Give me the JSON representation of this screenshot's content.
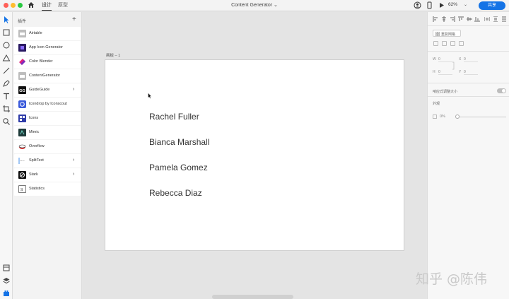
{
  "titlebar": {
    "mode_tabs": [
      "设计",
      "原型"
    ],
    "document_title": "Content Generator ⌄",
    "zoom": "62%",
    "zoom_arrow": "⌄",
    "share_label": "共享"
  },
  "colors": {
    "accent": "#1473e6",
    "close": "#ff5f57",
    "minimize": "#febc2e",
    "maximize": "#28c840"
  },
  "plugins": {
    "header": "插件",
    "add": "+",
    "items": [
      {
        "label": "Airtable",
        "icon": "airtable-icon",
        "chevron": ""
      },
      {
        "label": "App Icon Generator",
        "icon": "app-icon-generator-icon",
        "chevron": ""
      },
      {
        "label": "Color Blender",
        "icon": "color-blender-icon",
        "chevron": ""
      },
      {
        "label": "ContentGenerator",
        "icon": "content-generator-icon",
        "chevron": ""
      },
      {
        "label": "GuideGuide",
        "icon": "guideguide-icon",
        "chevron": "›"
      },
      {
        "label": "Icondrop by Iconscout",
        "icon": "icondrop-icon",
        "chevron": ""
      },
      {
        "label": "Icons",
        "icon": "icons-plugin-icon",
        "chevron": ""
      },
      {
        "label": "Mimic",
        "icon": "mimic-icon",
        "chevron": ""
      },
      {
        "label": "Overflow",
        "icon": "overflow-icon",
        "chevron": ""
      },
      {
        "label": "SplitText",
        "icon": "splittext-icon",
        "chevron": "›"
      },
      {
        "label": "Stark",
        "icon": "stark-icon",
        "chevron": "›"
      },
      {
        "label": "Statistics",
        "icon": "statistics-icon",
        "chevron": ""
      }
    ]
  },
  "canvas": {
    "artboard_label": "画板 – 1",
    "names": [
      "Rachel Fuller",
      "Bianca Marshall",
      "Pamela Gomez",
      "Rebecca Diaz"
    ]
  },
  "properties": {
    "repeat_grid": "重复网格",
    "w_label": "W",
    "w_value": "0",
    "h_label": "H",
    "h_value": "0",
    "x_label": "X",
    "x_value": "0",
    "y_label": "Y",
    "y_value": "0",
    "responsive_resize": "响应式调整大小",
    "appearance": "外观",
    "opacity": "0%"
  },
  "watermark": "知乎 @陈伟"
}
